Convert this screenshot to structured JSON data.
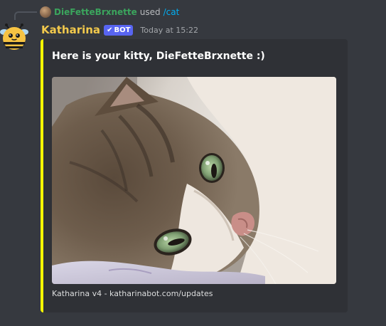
{
  "reply": {
    "user": "DieFetteBrxnette",
    "used": "used",
    "command": "/cat"
  },
  "message": {
    "author": "Katharina",
    "badge": "BOT",
    "timestamp": "Today at 15:22"
  },
  "embed": {
    "title": "Here is your kitty, DieFetteBrxnette :)",
    "footer": "Katharina v4 - katharinabot.com/updates",
    "accent_color": "#f6f900"
  },
  "colors": {
    "background": "#36393f",
    "embed_background": "#2f3136",
    "username": "#f2c94c",
    "reply_user": "#3ba55d",
    "command": "#00aff4",
    "bot_badge": "#5865f2"
  },
  "icons": {
    "avatar": "bee-avatar-icon",
    "reply_avatar": "user-avatar-icon",
    "badge_check": "checkmark-icon"
  }
}
